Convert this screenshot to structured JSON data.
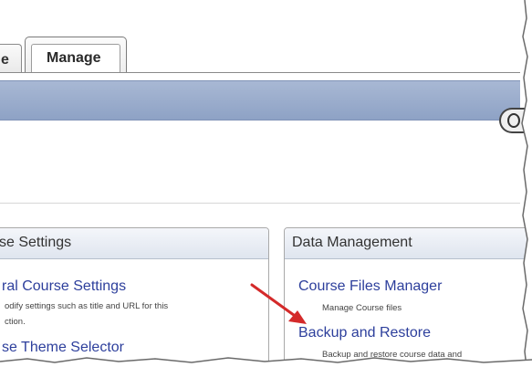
{
  "tabs": {
    "previous_label": "e",
    "active_label": "Manage"
  },
  "left_panel": {
    "title": "se Settings",
    "link1_label": "ral Course Settings",
    "link1_desc_line1": "odify settings such as title and URL for this",
    "link1_desc_line2": "ction.",
    "link2_label": "se Theme Selector"
  },
  "right_panel": {
    "title": "Data Management",
    "link1_label": "Course Files Manager",
    "link1_desc": "Manage Course files",
    "link2_label": "Backup and Restore",
    "link2_desc": "Backup and restore course data and"
  },
  "icons": {
    "round_button": "search-icon",
    "annotation": "red-arrow-icon"
  },
  "colors": {
    "header_bar": "#98abcb",
    "link": "#2d3f9c",
    "arrow": "#d42a2a"
  }
}
